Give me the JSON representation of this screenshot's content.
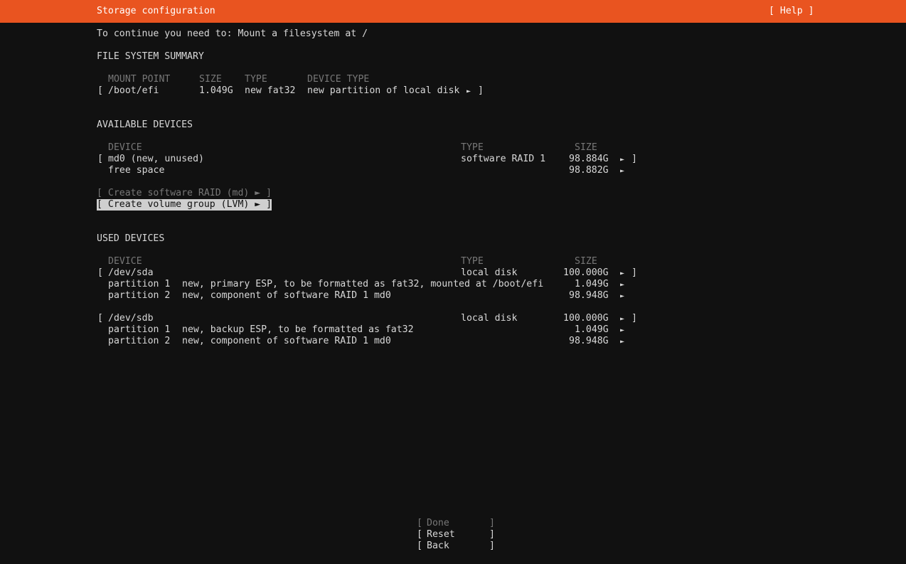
{
  "header": {
    "title": "Storage configuration",
    "help": "[ Help ]"
  },
  "instruction": "To continue you need to: Mount a filesystem at /",
  "fs_summary": {
    "heading": "FILE SYSTEM SUMMARY",
    "columns": [
      "MOUNT POINT",
      "SIZE",
      "TYPE",
      "DEVICE TYPE"
    ],
    "rows": [
      {
        "open": "[",
        "mount": "/boot/efi",
        "size": "1.049G",
        "type": "new fat32",
        "device_type": "new partition of local disk",
        "arrow": "►",
        "close": "]"
      }
    ]
  },
  "available": {
    "heading": "AVAILABLE DEVICES",
    "columns": {
      "device": "DEVICE",
      "type": "TYPE",
      "size": "SIZE"
    },
    "device": {
      "open": "[",
      "name": "md0 (new, unused)",
      "type": "software RAID 1",
      "size": "98.884G",
      "arrow": "►",
      "close": "]"
    },
    "free": {
      "name": "free space",
      "size": "98.882G",
      "arrow": "►"
    },
    "actions": [
      {
        "label": "[ Create software RAID (md) ► ]",
        "enabled": false
      },
      {
        "label": "[ Create volume group (LVM) ► ]",
        "enabled": true,
        "selected": true
      }
    ]
  },
  "used": {
    "heading": "USED DEVICES",
    "columns": {
      "device": "DEVICE",
      "type": "TYPE",
      "size": "SIZE"
    },
    "disks": [
      {
        "open": "[",
        "name": "/dev/sda",
        "type": "local disk",
        "size": "100.000G",
        "arrow": "►",
        "close": "]",
        "partitions": [
          {
            "name": "partition 1",
            "desc": "new, primary ESP, to be formatted as fat32, mounted at /boot/efi",
            "size": "1.049G",
            "arrow": "►"
          },
          {
            "name": "partition 2",
            "desc": "new, component of software RAID 1 md0",
            "size": "98.948G",
            "arrow": "►"
          }
        ]
      },
      {
        "open": "[",
        "name": "/dev/sdb",
        "type": "local disk",
        "size": "100.000G",
        "arrow": "►",
        "close": "]",
        "partitions": [
          {
            "name": "partition 1",
            "desc": "new, backup ESP, to be formatted as fat32",
            "size": "1.049G",
            "arrow": "►"
          },
          {
            "name": "partition 2",
            "desc": "new, component of software RAID 1 md0",
            "size": "98.948G",
            "arrow": "►"
          }
        ]
      }
    ]
  },
  "buttons": {
    "done": {
      "open": "[",
      "label": "Done",
      "close": "]",
      "enabled": false
    },
    "reset": {
      "open": "[",
      "label": "Reset",
      "close": "]",
      "enabled": true
    },
    "back": {
      "open": "[",
      "label": "Back",
      "close": "]",
      "enabled": true
    }
  },
  "colors": {
    "header_bg": "#e95420",
    "background": "#111111",
    "text": "#d8d8d8",
    "disabled": "#777777",
    "selection_bg": "#cfcfcf"
  }
}
